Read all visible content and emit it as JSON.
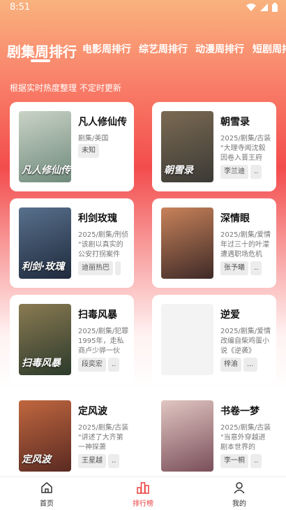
{
  "status_bar": {
    "time": "8:51"
  },
  "tabs": [
    {
      "label": "剧集周排行",
      "active": true
    },
    {
      "label": "电影周排行"
    },
    {
      "label": "综艺周排行"
    },
    {
      "label": "动漫周排行"
    },
    {
      "label": "短剧周排行"
    }
  ],
  "subtitle": "根据实时热度整理 不定时更新",
  "cards": [
    {
      "title": "凡人修仙传",
      "meta": "剧集/美国",
      "desc": "",
      "tags": [
        "未知"
      ],
      "poster_text": "凡人修仙传",
      "poster_colors": [
        "#6f8a7c",
        "#c9d3c6"
      ]
    },
    {
      "title": "朝雪录",
      "meta": "2025/剧集/古装",
      "desc": "\"大理寺闻沈毅因卷入晋王府",
      "tags": [
        "李兰迪",
        ".."
      ],
      "poster_text": "朝雪录",
      "poster_colors": [
        "#3b3a36",
        "#7b6a52"
      ]
    },
    {
      "title": "利剑玫瑰",
      "meta": "2025/剧集/刑侦",
      "desc": "\"该剧以真实的公安打拐案件",
      "tags": [
        "迪丽热巴",
        ""
      ],
      "poster_text": "利剑·玫瑰",
      "poster_colors": [
        "#1f2a3c",
        "#58708c"
      ]
    },
    {
      "title": "深情眼",
      "meta": "2025/剧集/爱情",
      "desc": "年过三十的叶濛遭遇职场危机",
      "tags": [
        "张予曦",
        ".."
      ],
      "poster_text": "",
      "poster_colors": [
        "#3e2a27",
        "#c8825a"
      ]
    },
    {
      "title": "扫毒风暴",
      "meta": "2025/剧集/犯罪",
      "desc": "1995年，走私商卢少骅一伙",
      "tags": [
        "段奕宏",
        ".."
      ],
      "poster_text": "扫毒风暴",
      "poster_colors": [
        "#2c3a2b",
        "#8a7a52"
      ]
    },
    {
      "title": "逆爱",
      "meta": "2025/剧集/爱情",
      "desc": "改编自柴鸡蛋小说《逆袭》",
      "tags": [
        "梓渝",
        "..."
      ],
      "poster_text": "",
      "poster_colors": [
        "#f3f3f3",
        "#f3f3f3"
      ]
    },
    {
      "title": "定风波",
      "meta": "2025/剧集/古装",
      "desc": "\"讲述了大齐第一神探萧",
      "tags": [
        "王星越",
        ".."
      ],
      "poster_text": "定风波",
      "poster_colors": [
        "#5a2a22",
        "#c0673f"
      ]
    },
    {
      "title": "书卷一梦",
      "meta": "2025/剧集/古装",
      "desc": "\"当意外穿越进剧本世界的",
      "tags": [
        "李一桐",
        ".."
      ],
      "poster_text": "",
      "poster_colors": [
        "#7a4f5a",
        "#e1c6c2"
      ]
    }
  ],
  "bottom_nav": [
    {
      "label": "首页",
      "icon": "home-icon"
    },
    {
      "label": "排行榜",
      "icon": "ranking-icon",
      "active": true
    },
    {
      "label": "我的",
      "icon": "profile-icon"
    }
  ],
  "colors": {
    "accent": "#e8403f",
    "gradient_top": "#f9b27e",
    "gradient_mid": "#f34c4c"
  }
}
